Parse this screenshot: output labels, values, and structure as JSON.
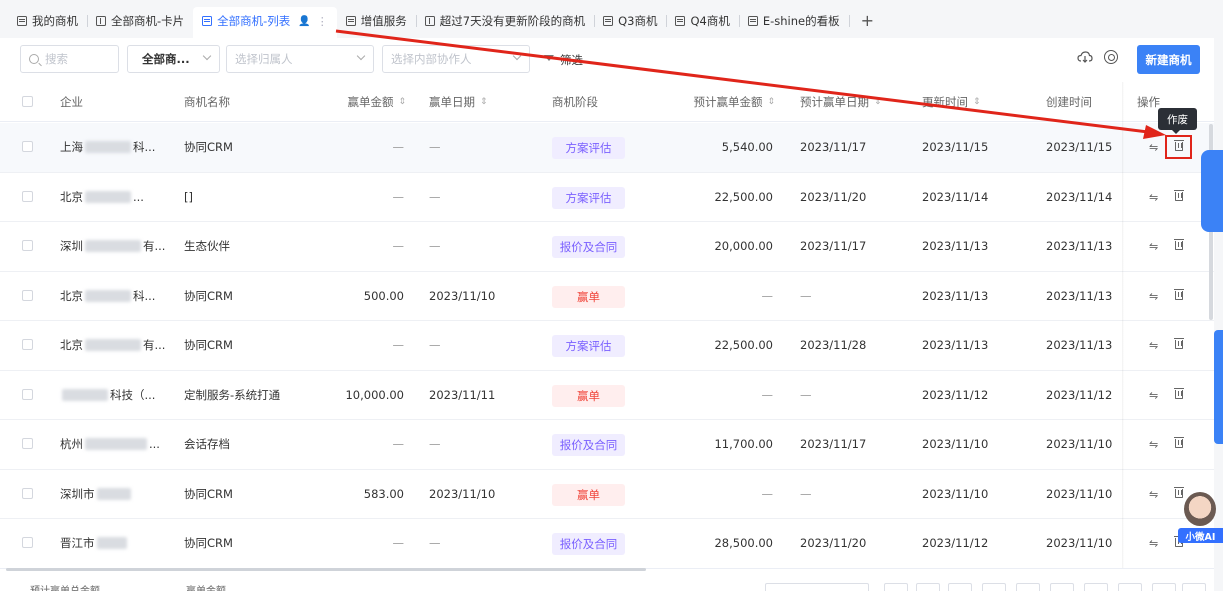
{
  "tabs": [
    {
      "label": "我的商机",
      "icon": "list-icon"
    },
    {
      "label": "全部商机-卡片",
      "icon": "grid-icon"
    },
    {
      "label": "全部商机-列表",
      "icon": "list-icon",
      "active": true
    },
    {
      "label": "增值服务",
      "icon": "list-icon"
    },
    {
      "label": "超过7天没有更新阶段的商机",
      "icon": "grid-icon"
    },
    {
      "label": "Q3商机",
      "icon": "list-icon"
    },
    {
      "label": "Q4商机",
      "icon": "list-icon"
    },
    {
      "label": "E-shine的看板",
      "icon": "list-icon"
    }
  ],
  "toolbar": {
    "search_placeholder": "搜索",
    "scope_select": "全部商...",
    "owner_placeholder": "选择归属人",
    "collaborator_placeholder": "选择内部协作人",
    "filter_label": "筛选",
    "new_button": "新建商机"
  },
  "table": {
    "columns": [
      "企业",
      "商机名称",
      "赢单金额",
      "赢单日期",
      "商机阶段",
      "预计赢单金额",
      "预计赢单日期",
      "更新时间",
      "创建时间",
      "操作"
    ],
    "rows": [
      {
        "company_a": "上海",
        "company_b": "科...",
        "name": "协同CRM",
        "amount": "—",
        "date": "—",
        "stage": "方案评估",
        "est_amount": "5,540.00",
        "est_date": "2023/11/17",
        "updated": "2023/11/15",
        "created": "2023/11/15"
      },
      {
        "company_a": "北京",
        "company_b": "...",
        "name": "[]",
        "amount": "—",
        "date": "—",
        "stage": "方案评估",
        "est_amount": "22,500.00",
        "est_date": "2023/11/20",
        "updated": "2023/11/14",
        "created": "2023/11/14"
      },
      {
        "company_a": "深圳",
        "company_b": "有...",
        "name": "生态伙伴",
        "amount": "—",
        "date": "—",
        "stage": "报价及合同",
        "est_amount": "20,000.00",
        "est_date": "2023/11/17",
        "updated": "2023/11/13",
        "created": "2023/11/13"
      },
      {
        "company_a": "北京",
        "company_b": "科...",
        "name": "协同CRM",
        "amount": "500.00",
        "date": "2023/11/10",
        "stage": "赢单",
        "est_amount": "—",
        "est_date": "—",
        "updated": "2023/11/13",
        "created": "2023/11/13"
      },
      {
        "company_a": "北京",
        "company_b": "有...",
        "name": "协同CRM",
        "amount": "—",
        "date": "—",
        "stage": "方案评估",
        "est_amount": "22,500.00",
        "est_date": "2023/11/28",
        "updated": "2023/11/13",
        "created": "2023/11/13"
      },
      {
        "company_a": "",
        "company_b": "科技（...",
        "name": "定制服务-系统打通",
        "amount": "10,000.00",
        "date": "2023/11/11",
        "stage": "赢单",
        "est_amount": "—",
        "est_date": "—",
        "updated": "2023/11/12",
        "created": "2023/11/12"
      },
      {
        "company_a": "杭州",
        "company_b": "...",
        "name": "会话存档",
        "amount": "—",
        "date": "—",
        "stage": "报价及合同",
        "est_amount": "11,700.00",
        "est_date": "2023/11/17",
        "updated": "2023/11/10",
        "created": "2023/11/10"
      },
      {
        "company_a": "深圳市",
        "company_b": "",
        "name": "协同CRM",
        "amount": "583.00",
        "date": "2023/11/10",
        "stage": "赢单",
        "est_amount": "—",
        "est_date": "—",
        "updated": "2023/11/10",
        "created": "2023/11/10"
      },
      {
        "company_a": "晋江市",
        "company_b": "",
        "name": "协同CRM",
        "amount": "—",
        "date": "—",
        "stage": "报价及合同",
        "est_amount": "28,500.00",
        "est_date": "2023/11/20",
        "updated": "2023/11/12",
        "created": "2023/11/10"
      }
    ]
  },
  "stage_styles": {
    "方案评估": {
      "bg": "#f0edff",
      "color": "#7b61ff"
    },
    "报价及合同": {
      "bg": "#f0edff",
      "color": "#7b61ff"
    },
    "赢单": {
      "bg": "#ffeeee",
      "color": "#f0453a"
    }
  },
  "footer": {
    "est_total_label": "预计赢单总金额",
    "won_total_label": "赢单金额"
  },
  "tooltip": "作废",
  "ai_badge": "小微AI",
  "accent_color": "#3b82f6",
  "annotation_color": "#e0251a"
}
